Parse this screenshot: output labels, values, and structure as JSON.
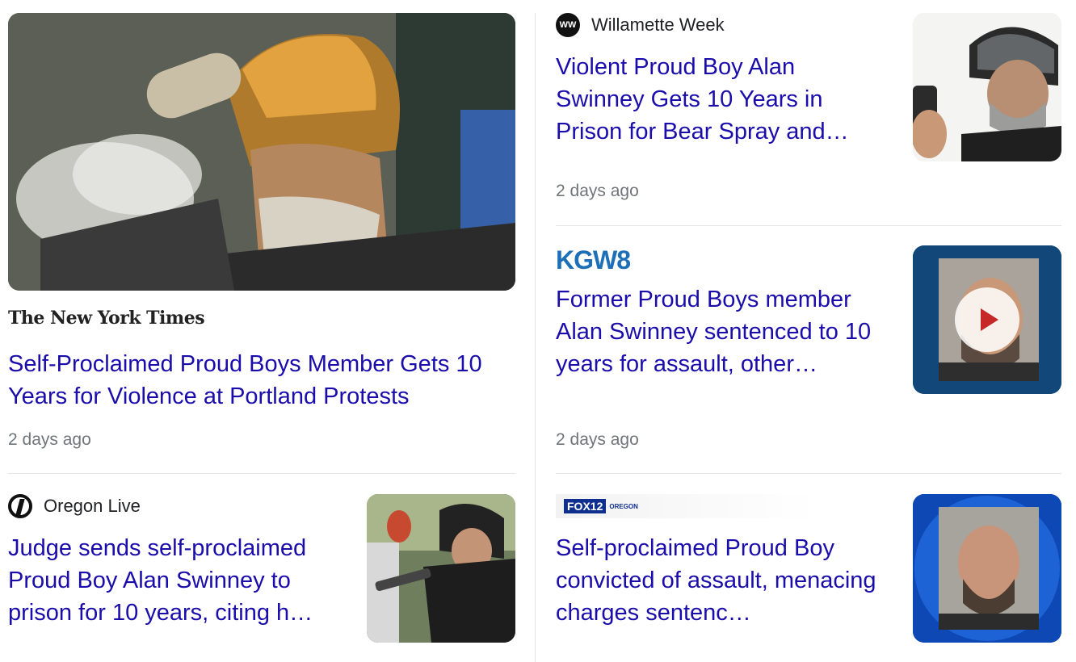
{
  "articles": [
    {
      "source": "The New York Times",
      "title": "Self-Proclaimed Proud Boys Member Gets 10 Years for Violence at Portland Protests",
      "time": "2 days ago",
      "image": "helmeted-protester-smoke-photo"
    },
    {
      "source": "Willamette Week",
      "source_logo": "WW",
      "title": "Violent Proud Boy Alan Swinney Gets 10 Years in Prison for Bear Spray and…",
      "time": "2 days ago",
      "image": "riot-helmet-man-with-phone-photo"
    },
    {
      "source": "KGW8",
      "title": "Former Proud Boys member Alan Swinney sentenced to 10 years for assault, other…",
      "time": "2 days ago",
      "image": "mugshot-video-thumbnail",
      "media": "play-icon"
    },
    {
      "source": "Oregon Live",
      "title": "Judge sends self-proclaimed Proud Boy Alan Swinney to prison for 10 years, citing h…",
      "image": "protester-with-gun-photo"
    },
    {
      "source": "FOX 12",
      "source_logo": "FOX12",
      "source_sub": "OREGON",
      "title": "Self-proclaimed Proud Boy convicted of assault, menacing charges sentenc…",
      "image": "mugshot-blue-background"
    }
  ]
}
